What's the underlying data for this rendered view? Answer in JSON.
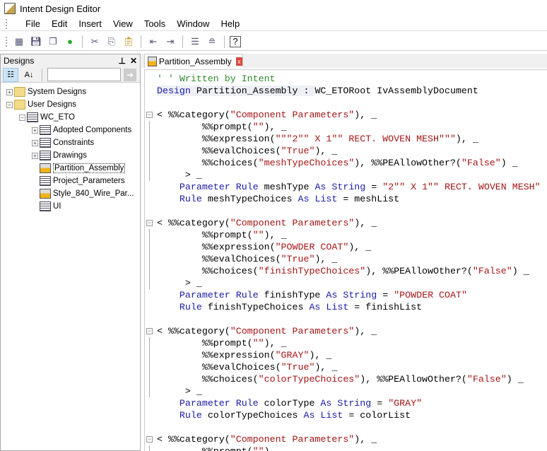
{
  "window": {
    "title": "Intent Design Editor"
  },
  "menu": [
    "File",
    "Edit",
    "Insert",
    "View",
    "Tools",
    "Window",
    "Help"
  ],
  "toolbar": {
    "icons": [
      "new-icon",
      "save-icon",
      "save-all-icon",
      "traffic-light-icon",
      "cut-icon",
      "copy-icon",
      "paste-icon",
      "outdent-icon",
      "indent-icon",
      "comment-icon",
      "uncomment-icon",
      "help-icon"
    ]
  },
  "panel": {
    "title": "Designs",
    "pin": "⊥",
    "close": "✕",
    "search_value": "",
    "tree": [
      {
        "label": "System Designs",
        "level": 0,
        "exp": "+",
        "icon": "folder"
      },
      {
        "label": "User Designs",
        "level": 0,
        "exp": "−",
        "icon": "folder"
      },
      {
        "label": "WC_ETO",
        "level": 1,
        "exp": "−",
        "icon": "asm-folder"
      },
      {
        "label": "Adopted Components",
        "level": 2,
        "exp": "+",
        "icon": "doc"
      },
      {
        "label": "Constraints",
        "level": 2,
        "exp": "+",
        "icon": "doc"
      },
      {
        "label": "Drawings",
        "level": 2,
        "exp": "+",
        "icon": "doc"
      },
      {
        "label": "Partition_Assembly",
        "level": 2,
        "exp": "",
        "icon": "asm",
        "selected": true
      },
      {
        "label": "Project_Parameters",
        "level": 2,
        "exp": "",
        "icon": "doc"
      },
      {
        "label": "Style_840_Wire_Par...",
        "level": 2,
        "exp": "",
        "icon": "asm"
      },
      {
        "label": "UI",
        "level": 2,
        "exp": "",
        "icon": "doc"
      }
    ]
  },
  "editor": {
    "tab": "Partition_Assembly",
    "tab_close": "x",
    "lines": [
      {
        "t": [
          [
            "c",
            "' ' Written by Intent"
          ]
        ]
      },
      {
        "hl": true,
        "t": [
          [
            "k",
            "Design"
          ],
          [
            "t",
            " Partition_Assembly : "
          ]
        ],
        "rest": [
          [
            "t",
            "WC_ETORoot IvAssemblyDocument"
          ]
        ]
      },
      {
        "t": []
      },
      {
        "fold": true,
        "t": [
          [
            "t",
            "< %%category("
          ],
          [
            "s",
            "\"Component Parameters\""
          ],
          [
            "t",
            "), _"
          ]
        ]
      },
      {
        "g": true,
        "t": [
          [
            "t",
            "        %%prompt("
          ],
          [
            "s",
            "\"\""
          ],
          [
            "t",
            "), _"
          ]
        ]
      },
      {
        "g": true,
        "t": [
          [
            "t",
            "        %%expression("
          ],
          [
            "s",
            "\"\"\"2\"\" X 1\"\" RECT. WOVEN MESH\"\"\""
          ],
          [
            "t",
            "), _"
          ]
        ]
      },
      {
        "g": true,
        "t": [
          [
            "t",
            "        %%evalChoices("
          ],
          [
            "s",
            "\"True\""
          ],
          [
            "t",
            "), _"
          ]
        ]
      },
      {
        "g": true,
        "t": [
          [
            "t",
            "        %%choices("
          ],
          [
            "s",
            "\"meshTypeChoices\""
          ],
          [
            "t",
            "), %%PEAllowOther?("
          ],
          [
            "s",
            "\"False\""
          ],
          [
            "t",
            ") _"
          ]
        ]
      },
      {
        "g": true,
        "t": [
          [
            "t",
            "     > _"
          ]
        ]
      },
      {
        "t": [
          [
            "t",
            "    "
          ],
          [
            "k",
            "Parameter Rule"
          ],
          [
            "t",
            " meshType "
          ],
          [
            "k",
            "As String"
          ],
          [
            "t",
            " = "
          ],
          [
            "s",
            "\"2\"\" X 1\"\" RECT. WOVEN MESH\""
          ]
        ]
      },
      {
        "t": [
          [
            "t",
            "    "
          ],
          [
            "k",
            "Rule"
          ],
          [
            "t",
            " meshTypeChoices "
          ],
          [
            "k",
            "As List"
          ],
          [
            "t",
            " = meshList"
          ]
        ]
      },
      {
        "t": []
      },
      {
        "fold": true,
        "t": [
          [
            "t",
            "< %%category("
          ],
          [
            "s",
            "\"Component Parameters\""
          ],
          [
            "t",
            "), _"
          ]
        ]
      },
      {
        "g": true,
        "t": [
          [
            "t",
            "        %%prompt("
          ],
          [
            "s",
            "\"\""
          ],
          [
            "t",
            "), _"
          ]
        ]
      },
      {
        "g": true,
        "t": [
          [
            "t",
            "        %%expression("
          ],
          [
            "s",
            "\"POWDER COAT\""
          ],
          [
            "t",
            "), _"
          ]
        ]
      },
      {
        "g": true,
        "t": [
          [
            "t",
            "        %%evalChoices("
          ],
          [
            "s",
            "\"True\""
          ],
          [
            "t",
            "), _"
          ]
        ]
      },
      {
        "g": true,
        "t": [
          [
            "t",
            "        %%choices("
          ],
          [
            "s",
            "\"finishTypeChoices\""
          ],
          [
            "t",
            "), %%PEAllowOther?("
          ],
          [
            "s",
            "\"False\""
          ],
          [
            "t",
            ") _"
          ]
        ]
      },
      {
        "g": true,
        "t": [
          [
            "t",
            "     > _"
          ]
        ]
      },
      {
        "t": [
          [
            "t",
            "    "
          ],
          [
            "k",
            "Parameter Rule"
          ],
          [
            "t",
            " finishType "
          ],
          [
            "k",
            "As String"
          ],
          [
            "t",
            " = "
          ],
          [
            "s",
            "\"POWDER COAT\""
          ]
        ]
      },
      {
        "t": [
          [
            "t",
            "    "
          ],
          [
            "k",
            "Rule"
          ],
          [
            "t",
            " finishTypeChoices "
          ],
          [
            "k",
            "As List"
          ],
          [
            "t",
            " = finishList"
          ]
        ]
      },
      {
        "t": []
      },
      {
        "fold": true,
        "t": [
          [
            "t",
            "< %%category("
          ],
          [
            "s",
            "\"Component Parameters\""
          ],
          [
            "t",
            "), _"
          ]
        ]
      },
      {
        "g": true,
        "t": [
          [
            "t",
            "        %%prompt("
          ],
          [
            "s",
            "\"\""
          ],
          [
            "t",
            "), _"
          ]
        ]
      },
      {
        "g": true,
        "t": [
          [
            "t",
            "        %%expression("
          ],
          [
            "s",
            "\"GRAY\""
          ],
          [
            "t",
            "), _"
          ]
        ]
      },
      {
        "g": true,
        "t": [
          [
            "t",
            "        %%evalChoices("
          ],
          [
            "s",
            "\"True\""
          ],
          [
            "t",
            "), _"
          ]
        ]
      },
      {
        "g": true,
        "t": [
          [
            "t",
            "        %%choices("
          ],
          [
            "s",
            "\"colorTypeChoices\""
          ],
          [
            "t",
            "), %%PEAllowOther?("
          ],
          [
            "s",
            "\"False\""
          ],
          [
            "t",
            ") _"
          ]
        ]
      },
      {
        "g": true,
        "t": [
          [
            "t",
            "     > _"
          ]
        ]
      },
      {
        "t": [
          [
            "t",
            "    "
          ],
          [
            "k",
            "Parameter Rule"
          ],
          [
            "t",
            " colorType "
          ],
          [
            "k",
            "As String"
          ],
          [
            "t",
            " = "
          ],
          [
            "s",
            "\"GRAY\""
          ]
        ]
      },
      {
        "t": [
          [
            "t",
            "    "
          ],
          [
            "k",
            "Rule"
          ],
          [
            "t",
            " colorTypeChoices "
          ],
          [
            "k",
            "As List"
          ],
          [
            "t",
            " = colorList"
          ]
        ]
      },
      {
        "t": []
      },
      {
        "fold": true,
        "t": [
          [
            "t",
            "< %%category("
          ],
          [
            "s",
            "\"Component Parameters\""
          ],
          [
            "t",
            "), _"
          ]
        ]
      },
      {
        "g": true,
        "t": [
          [
            "t",
            "        %%prompt("
          ],
          [
            "s",
            "\"\""
          ],
          [
            "t",
            ")"
          ]
        ]
      }
    ]
  }
}
